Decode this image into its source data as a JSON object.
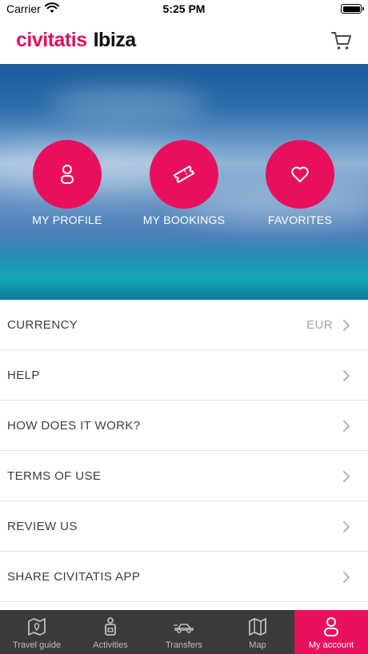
{
  "status_bar": {
    "carrier": "Carrier",
    "time": "5:25 PM"
  },
  "header": {
    "brand": "civitatis",
    "city": "Ibiza",
    "cart_icon": "cart-icon"
  },
  "hero": {
    "actions": [
      {
        "label": "MY PROFILE",
        "icon": "person-icon"
      },
      {
        "label": "MY BOOKINGS",
        "icon": "ticket-icon"
      },
      {
        "label": "FAVORITES",
        "icon": "heart-icon"
      }
    ]
  },
  "menu": {
    "items": [
      {
        "label": "CURRENCY",
        "value": "EUR"
      },
      {
        "label": "HELP"
      },
      {
        "label": "HOW DOES IT WORK?"
      },
      {
        "label": "TERMS OF USE"
      },
      {
        "label": "REVIEW US"
      },
      {
        "label": "SHARE CIVITATIS APP"
      }
    ]
  },
  "tab_bar": {
    "tabs": [
      {
        "label": "Travel guide",
        "icon": "guide-map-icon"
      },
      {
        "label": "Activities",
        "icon": "activities-icon"
      },
      {
        "label": "Transfers",
        "icon": "car-icon"
      },
      {
        "label": "Map",
        "icon": "map-icon"
      },
      {
        "label": "My account",
        "icon": "person-icon",
        "active": true
      }
    ]
  },
  "colors": {
    "accent": "#e8105e",
    "tab_bar_bg": "#3a3a3a"
  }
}
